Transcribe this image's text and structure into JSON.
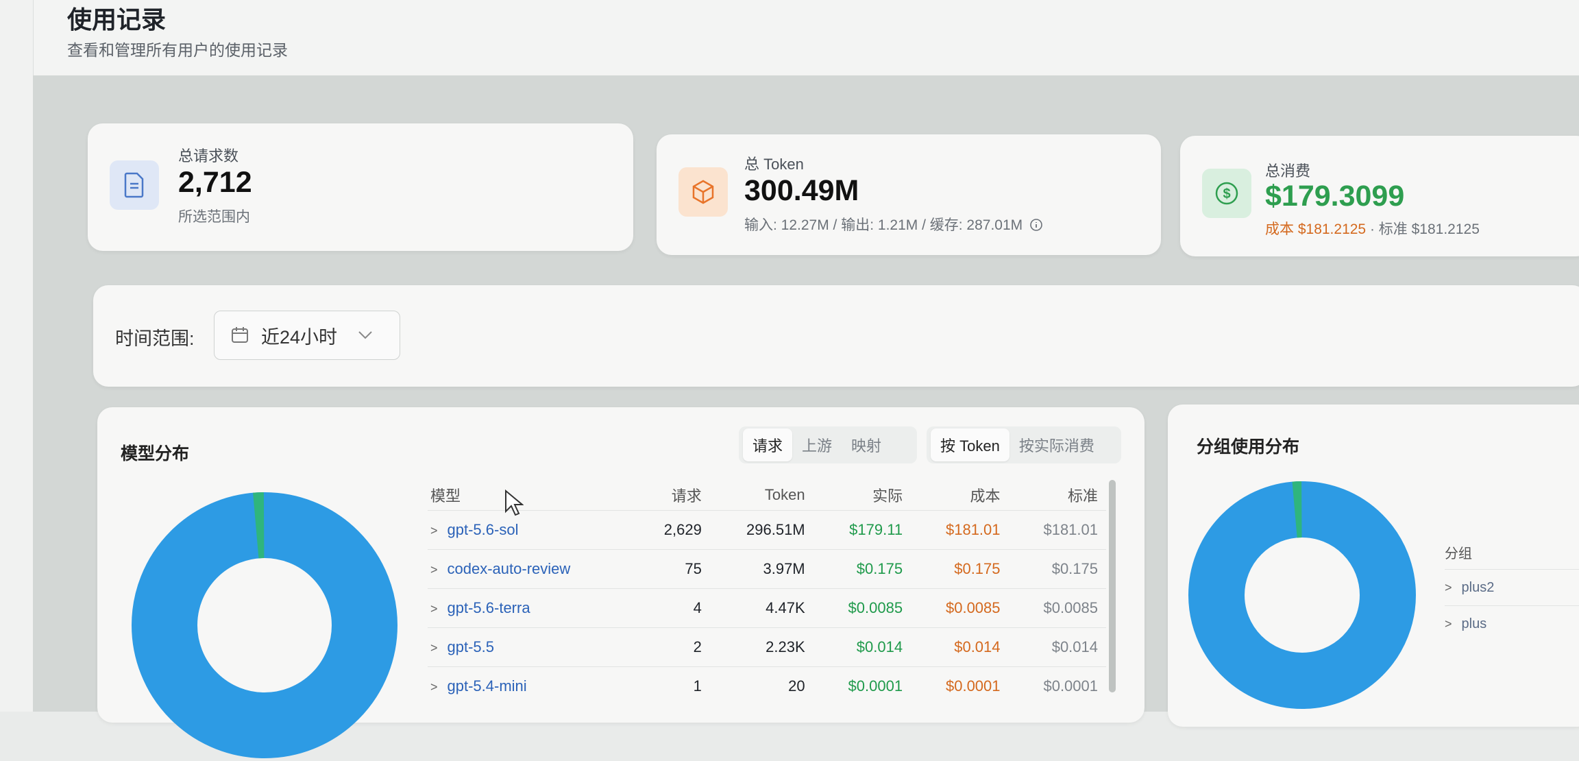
{
  "page": {
    "title": "使用记录",
    "subtitle": "查看和管理所有用户的使用记录"
  },
  "stats": {
    "requests": {
      "label": "总请求数",
      "value": "2,712",
      "sub": "所选范围内",
      "icon": "document-icon",
      "color": "#4a78c8"
    },
    "tokens": {
      "label": "总 Token",
      "value": "300.49M",
      "sub": "输入: 12.27M / 输出: 1.21M / 缓存: 287.01M",
      "icon": "cube-icon",
      "color": "#e8742a"
    },
    "cost": {
      "label": "总消费",
      "value": "$179.3099",
      "sub_cost": "成本 $181.2125",
      "sub_sep": " · ",
      "sub_std": "标准 $181.2125",
      "icon": "dollar-circle-icon",
      "color": "#2e9e4f"
    }
  },
  "filter": {
    "label": "时间范围:",
    "range_value": "近24小时"
  },
  "model_section": {
    "title": "模型分布",
    "tabs": [
      "请求",
      "上游",
      "映射"
    ],
    "active_tab": 0,
    "metrics": [
      "按 Token",
      "按实际消费"
    ],
    "active_metric": 0,
    "columns": [
      "模型",
      "请求",
      "Token",
      "实际",
      "成本",
      "标准"
    ],
    "rows": [
      {
        "model": "gpt-5.6-sol",
        "requests": "2,629",
        "tokens": "296.51M",
        "actual": "$179.11",
        "cost": "$181.01",
        "standard": "$181.01"
      },
      {
        "model": "codex-auto-review",
        "requests": "75",
        "tokens": "3.97M",
        "actual": "$0.175",
        "cost": "$0.175",
        "standard": "$0.175"
      },
      {
        "model": "gpt-5.6-terra",
        "requests": "4",
        "tokens": "4.47K",
        "actual": "$0.0085",
        "cost": "$0.0085",
        "standard": "$0.0085"
      },
      {
        "model": "gpt-5.5",
        "requests": "2",
        "tokens": "2.23K",
        "actual": "$0.014",
        "cost": "$0.014",
        "standard": "$0.014"
      },
      {
        "model": "gpt-5.4-mini",
        "requests": "1",
        "tokens": "20",
        "actual": "$0.0001",
        "cost": "$0.0001",
        "standard": "$0.0001"
      }
    ],
    "donut": {
      "main_color": "#2d9be4",
      "minor_color": "#2fb57d",
      "minor_share": 0.013
    }
  },
  "group_section": {
    "title": "分组使用分布",
    "column": "分组",
    "rows": [
      "plus2",
      "plus"
    ],
    "donut": {
      "main_color": "#2d9be4",
      "minor_color": "#2fb57d",
      "minor_share": 0.013
    }
  }
}
